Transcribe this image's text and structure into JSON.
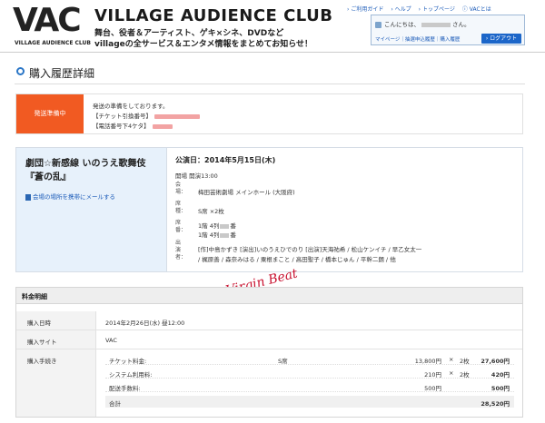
{
  "header": {
    "logo_text": "VAC",
    "logo_sub": "VILLAGE AUDIENCE CLUB",
    "site_title": "VILLAGE AUDIENCE CLUB",
    "tagline_1": "舞台、役者＆アーティスト、ゲキ×シネ、DVDなど",
    "tagline_2": "villageの全サービス＆エンタメ情報をまとめてお知らせ！",
    "top_links": [
      "ご利用ガイド",
      "ヘルプ",
      "トップページ",
      "VACとは"
    ],
    "user_greeting_prefix": "こんにちは、",
    "user_greeting_suffix": "さん。",
    "user_links": "マイページ｜抽選申込履歴｜購入履歴",
    "logout_label": "ログアウト"
  },
  "page_title": "購入履歴詳細",
  "status": {
    "badge": "発送準備中",
    "message": "発送の準備をしております。",
    "ticket_label": "【チケット引換番号】",
    "phone_label": "【電話番号下4ケタ】"
  },
  "event": {
    "name": "劇団☆新感線 いのうえ歌舞伎『蒼の乱』",
    "mail_link": "会場の場所を携帯にメールする",
    "performance_date": "公演日：2014年5月15日(木)",
    "times": "開場 開演13:00",
    "venue_label": "会場：",
    "venue": "梅田芸術劇場 メインホール (大阪府)",
    "seat_type_label": "席種：",
    "seat_type": "S席 ×2枚",
    "seat_no_label": "席番：",
    "seat_1": "1階 4列",
    "seat_2": "1階 4列",
    "seat_suffix": "番",
    "cast_label": "出演者：",
    "cast_1": "[作]中島かずき [演出]いのうえひでのり [出演]天海祐希 / 松山ケンイチ / 早乙女太一",
    "cast_2": "/ 梶原善 / 森奈みはる / 粟根まこと / 高田聖子 / 橋本じゅん / 平幹二朗 / 他"
  },
  "watermark": "Virgin Beat",
  "fees": {
    "heading": "料金明細",
    "purchase_date_label": "購入日時",
    "purchase_date": "2014年2月26日(水) 昼12:00",
    "site_label": "購入サイト",
    "site": "VAC",
    "method_label": "購入手続き",
    "lines": [
      {
        "name": "チケット料金:",
        "seat": "S席",
        "unit": "13,800円",
        "x": "×",
        "qty": "2枚",
        "amount": "27,600円"
      },
      {
        "name": "システム利用料:",
        "seat": "",
        "unit": "210円",
        "x": "×",
        "qty": "2枚",
        "amount": "420円"
      },
      {
        "name": "配送手数料:",
        "seat": "",
        "unit": "500円",
        "x": "",
        "qty": "",
        "amount": "500円"
      }
    ],
    "total_label": "合計",
    "total": "28,520円"
  }
}
